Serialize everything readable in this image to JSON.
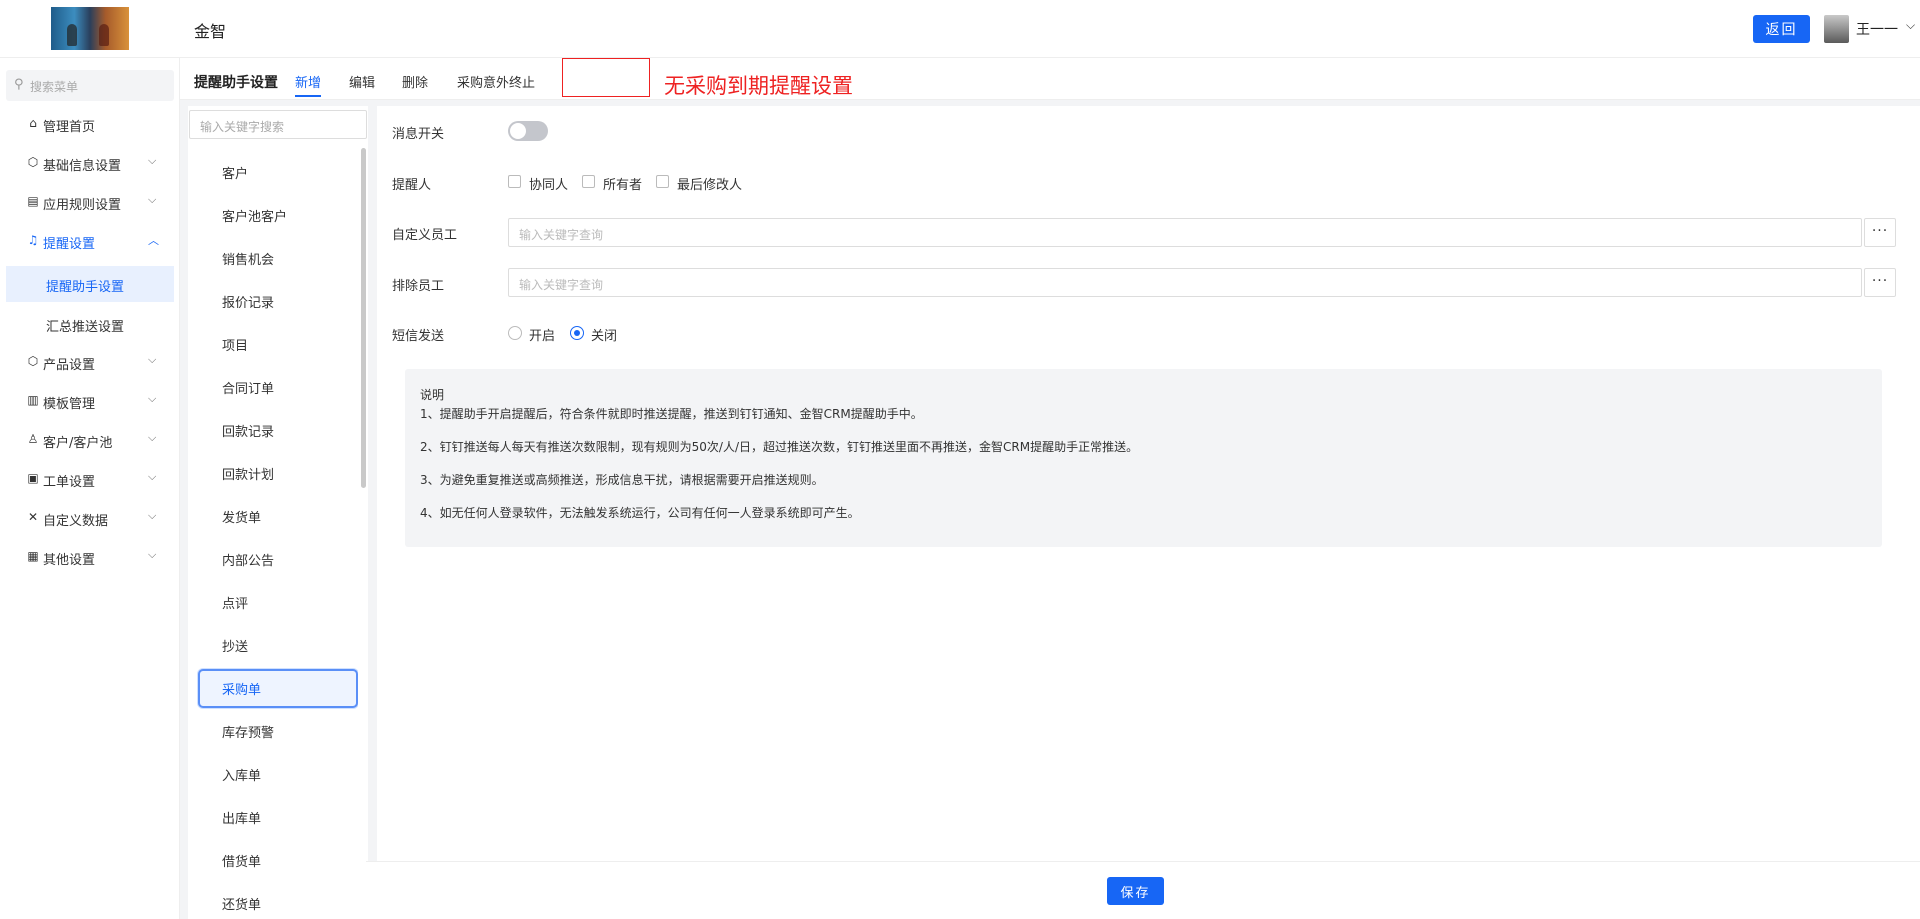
{
  "header": {
    "app_name": "金智",
    "back_label": "返回",
    "user_name": "王一一"
  },
  "sidebar": {
    "search_placeholder": "搜索菜单",
    "items": [
      {
        "label": "管理首页",
        "icon": "home-icon"
      },
      {
        "label": "基础信息设置",
        "icon": "cube-icon"
      },
      {
        "label": "应用规则设置",
        "icon": "document-icon"
      },
      {
        "label": "提醒设置",
        "icon": "bell-icon"
      },
      {
        "label": "产品设置",
        "icon": "cube-icon"
      },
      {
        "label": "模板管理",
        "icon": "template-icon"
      },
      {
        "label": "客户/客户池",
        "icon": "user-icon"
      },
      {
        "label": "工单设置",
        "icon": "ticket-icon"
      },
      {
        "label": "自定义数据",
        "icon": "tools-icon"
      },
      {
        "label": "其他设置",
        "icon": "grid-icon"
      }
    ],
    "sub_items": [
      {
        "label": "提醒助手设置"
      },
      {
        "label": "汇总推送设置"
      }
    ]
  },
  "page": {
    "title": "提醒助手设置",
    "tabs": [
      {
        "label": "新增"
      },
      {
        "label": "编辑"
      },
      {
        "label": "删除"
      },
      {
        "label": "采购意外终止"
      }
    ],
    "annotation": "无采购到期提醒设置"
  },
  "modules": {
    "search_placeholder": "输入关键字搜索",
    "items": [
      "客户",
      "客户池客户",
      "销售机会",
      "报价记录",
      "项目",
      "合同订单",
      "回款记录",
      "回款计划",
      "发货单",
      "内部公告",
      "点评",
      "抄送",
      "采购单",
      "库存预警",
      "入库单",
      "出库单",
      "借货单",
      "还货单"
    ],
    "selected": "采购单"
  },
  "form": {
    "message_switch": {
      "label": "消息开关",
      "on": false
    },
    "reminder": {
      "label": "提醒人",
      "options": [
        "协同人",
        "所有者",
        "最后修改人"
      ]
    },
    "custom_staff": {
      "label": "自定义员工",
      "placeholder": "输入关键字查询",
      "more": "···"
    },
    "exclude_staff": {
      "label": "排除员工",
      "placeholder": "输入关键字查询",
      "more": "···"
    },
    "sms": {
      "label": "短信发送",
      "options": [
        "开启",
        "关闭"
      ],
      "selected": "关闭"
    },
    "note": {
      "title": "说明",
      "lines": [
        "1、提醒助手开启提醒后，符合条件就即时推送提醒，推送到钉钉通知、金智CRM提醒助手中。",
        "2、钉钉推送每人每天有推送次数限制，现有规则为50次/人/日，超过推送次数，钉钉推送里面不再推送，金智CRM提醒助手正常推送。",
        "3、为避免重复推送或高频推送，形成信息干扰，请根据需要开启推送规则。",
        "4、如无任何人登录软件，无法触发系统运行，公司有任何一人登录系统即可产生。"
      ]
    }
  },
  "footer": {
    "save_label": "保存"
  },
  "colors": {
    "accent": "#1766f5",
    "annotation": "#e22222"
  }
}
